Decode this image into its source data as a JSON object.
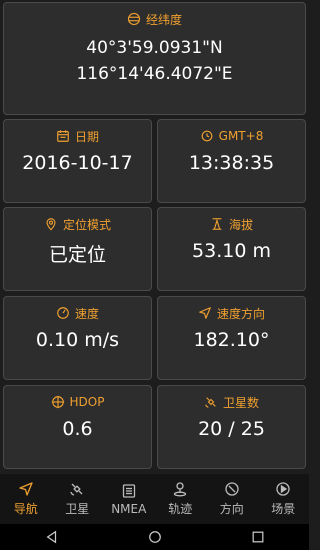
{
  "colors": {
    "accent": "#f0a030",
    "card_bg": "#2d2d2d",
    "card_border": "#4a4a4a",
    "page_bg": "#1d1d1d"
  },
  "latlon": {
    "label": "经纬度",
    "icon": "globe-icon",
    "lat": "40°3'59.0931\"N",
    "lon": "116°14'46.4072\"E"
  },
  "date": {
    "label": "日期",
    "icon": "calendar-icon",
    "value": "2016-10-17"
  },
  "time": {
    "label": "GMT+8",
    "icon": "clock-icon",
    "value": "13:38:35"
  },
  "mode": {
    "label": "定位模式",
    "icon": "location-pin-icon",
    "value": "已定位"
  },
  "altitude": {
    "label": "海拔",
    "icon": "altitude-icon",
    "value": "53.10 m"
  },
  "speed": {
    "label": "速度",
    "icon": "speedometer-icon",
    "value": "0.10 m/s"
  },
  "direction": {
    "label": "速度方向",
    "icon": "navigation-arrow-icon",
    "value": "182.10°"
  },
  "hdop": {
    "label": "HDOP",
    "icon": "crosshair-icon",
    "value": "0.6"
  },
  "satellites": {
    "label": "卫星数",
    "icon": "satellite-icon",
    "value": "20 / 25"
  },
  "tabs": [
    {
      "label": "导航",
      "icon": "navigation-icon",
      "active": true
    },
    {
      "label": "卫星",
      "icon": "satellite-icon"
    },
    {
      "label": "NMEA",
      "icon": "list-icon"
    },
    {
      "label": "轨迹",
      "icon": "track-pin-icon"
    },
    {
      "label": "方向",
      "icon": "compass-icon"
    },
    {
      "label": "场景",
      "icon": "play-icon"
    }
  ],
  "system_nav": [
    "back-icon",
    "home-icon",
    "recents-icon"
  ]
}
